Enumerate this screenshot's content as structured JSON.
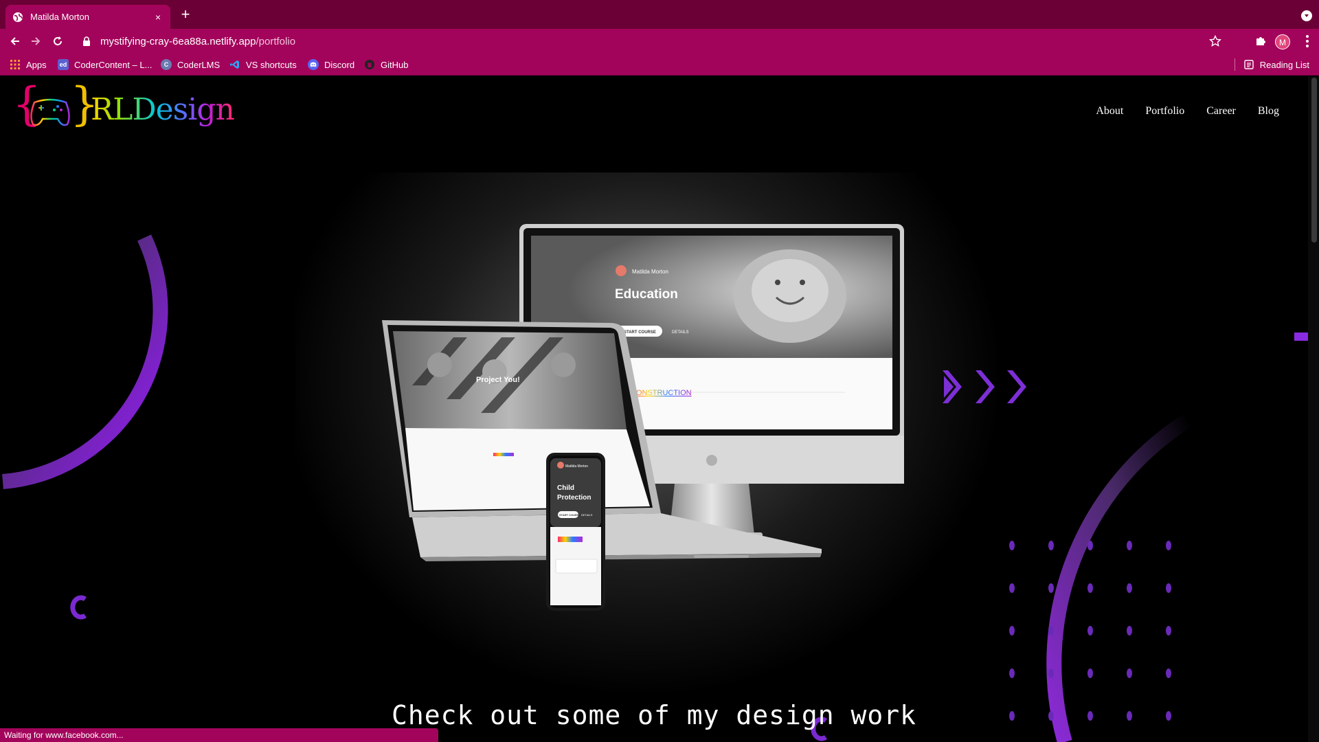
{
  "browser": {
    "tab_title": "Matilda Morton",
    "tab_close": "×",
    "new_tab": "+",
    "url_host": "mystifying-cray-6ea88a.netlify.app",
    "url_path": "/portfolio",
    "profile_initial": "M",
    "bookmarks": [
      {
        "label": "Apps",
        "icon": "apps-grid-icon"
      },
      {
        "label": "CoderContent – L...",
        "icon": "ed-icon"
      },
      {
        "label": "CoderLMS",
        "icon": "coderlms-icon"
      },
      {
        "label": "VS shortcuts",
        "icon": "vscode-icon"
      },
      {
        "label": "Discord",
        "icon": "discord-icon"
      },
      {
        "label": "GitHub",
        "icon": "github-icon"
      }
    ],
    "reading_list": "Reading List",
    "status_text": "Waiting for www.facebook.com...",
    "accent": "#a3045b",
    "tabstrip_color": "#6b0036"
  },
  "site": {
    "logo_open": "{",
    "logo_close": "}",
    "logo_text": "RLDesign",
    "nav": [
      "About",
      "Portfolio",
      "Career",
      "Blog"
    ],
    "hero_caption": "Check out some of my design work",
    "mockups": {
      "desktop_brand": "Matilda Morton",
      "desktop_heading": "Education",
      "desktop_button": "START COURSE",
      "desktop_details": "DETAILS",
      "desktop_section": "CONSTRUCTION",
      "laptop_heading": "Project You!",
      "phone_brand": "Matilda Morton",
      "phone_heading_line1": "Child",
      "phone_heading_line2": "Protection",
      "phone_button": "START COURSE",
      "phone_details": "DETAILS"
    },
    "accent_purple": "#8a2be2"
  }
}
